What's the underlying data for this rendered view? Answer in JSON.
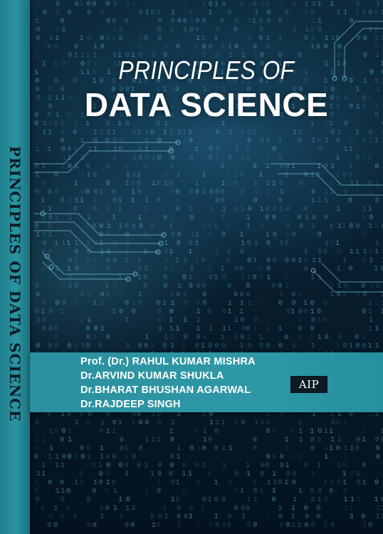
{
  "cover": {
    "title_line1": "PRINCIPLES OF",
    "title_line2": "DATA SCIENCE",
    "spine_title": "PRINCIPLES OF DATA SCIENCE",
    "authors": [
      "Prof. (Dr.) RAHUL KUMAR MISHRA",
      "Dr.ARVIND KUMAR SHUKLA",
      "Dr.BHARAT BHUSHAN AGARWAL",
      "Dr.RAJDEEP SINGH"
    ],
    "publisher_logo_text": "AIP",
    "colors": {
      "background": "#0a2233",
      "spine": "#2b94a2",
      "author_band": "#2e98a6",
      "binary_digits": "#5fb4d0",
      "circuit_lines": "#7cc8dc"
    }
  }
}
